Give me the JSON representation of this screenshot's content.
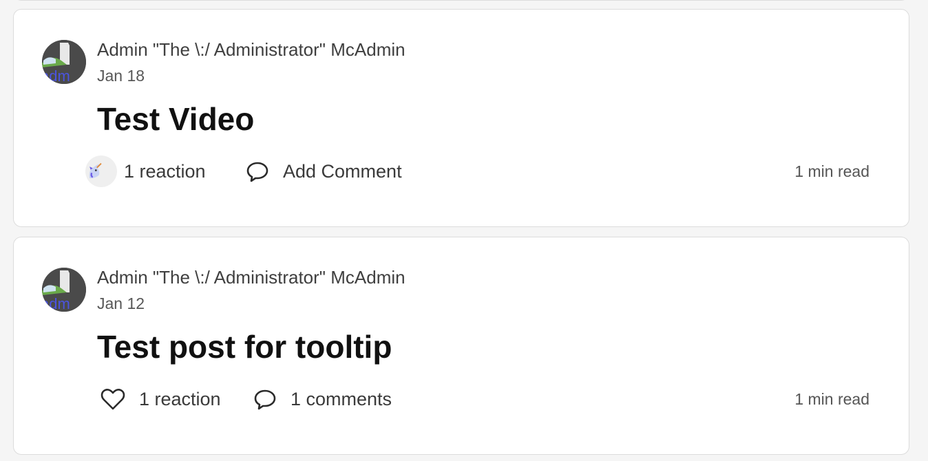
{
  "posts": [
    {
      "author": "Admin \"The \\:/ Administrator\" McAdmin",
      "date": "Jan 18",
      "title": "Test Video",
      "reaction_label": "1 reaction",
      "reaction_icon": "unicorn-emoji",
      "comment_label": "Add Comment",
      "read_time": "1 min read"
    },
    {
      "author": "Admin \"The \\:/ Administrator\" McAdmin",
      "date": "Jan 12",
      "title": "Test post for tooltip",
      "reaction_label": "1 reaction",
      "reaction_icon": "heart-icon",
      "comment_label": "1 comments",
      "read_time": "1 min read"
    }
  ],
  "colors": {
    "card_background": "#ffffff",
    "page_background": "#f5f5f5",
    "border": "#dcdcdc",
    "text_primary": "#111111",
    "text_secondary": "#575757"
  }
}
